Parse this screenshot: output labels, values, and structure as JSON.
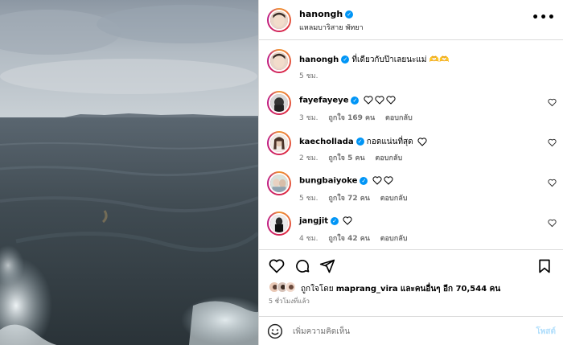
{
  "post": {
    "username": "hanongh",
    "location": "แหลมบาริสาย พัทยา",
    "more_label": "•••"
  },
  "caption": {
    "username": "hanongh",
    "text": "ที่เดียวกับป๊าเลยนะแม่ 🫶🫶",
    "time": "5 ชม."
  },
  "comments": [
    {
      "username": "fayefayeye",
      "text": "",
      "hearts": 3,
      "time": "3 ชม.",
      "likes": "ถูกใจ 169 คน",
      "reply": "ตอบกลับ"
    },
    {
      "username": "kaechollada",
      "text": "กอดแน่นที่สุด",
      "hearts": 1,
      "time": "2 ชม.",
      "likes": "ถูกใจ 5 คน",
      "reply": "ตอบกลับ"
    },
    {
      "username": "bungbaiyoke",
      "text": "",
      "hearts": 2,
      "time": "5 ชม.",
      "likes": "ถูกใจ 72 คน",
      "reply": "ตอบกลับ"
    },
    {
      "username": "jangjit",
      "text": "",
      "hearts": 1,
      "time": "4 ชม.",
      "likes": "ถูกใจ 42 คน",
      "reply": "ตอบกลับ"
    }
  ],
  "likes": {
    "prefix": "ถูกใจโดย",
    "user": "maprang_vira",
    "suffix": "และคนอื่นๆ อีก 70,544 คน"
  },
  "posted_ago": "5 ชั่วโมงที่แล้ว",
  "compose": {
    "placeholder": "เพิ่มความคิดเห็น",
    "post_label": "โพสต์"
  },
  "colors": {
    "verified": "#0095f6",
    "secondary_text": "#737373",
    "divider": "#dbdbdb",
    "post_button_disabled": "#b2dffc"
  },
  "icons": [
    "heart-icon",
    "comment-icon",
    "share-icon",
    "bookmark-icon",
    "emoji-icon",
    "more-icon",
    "verified-icon"
  ]
}
